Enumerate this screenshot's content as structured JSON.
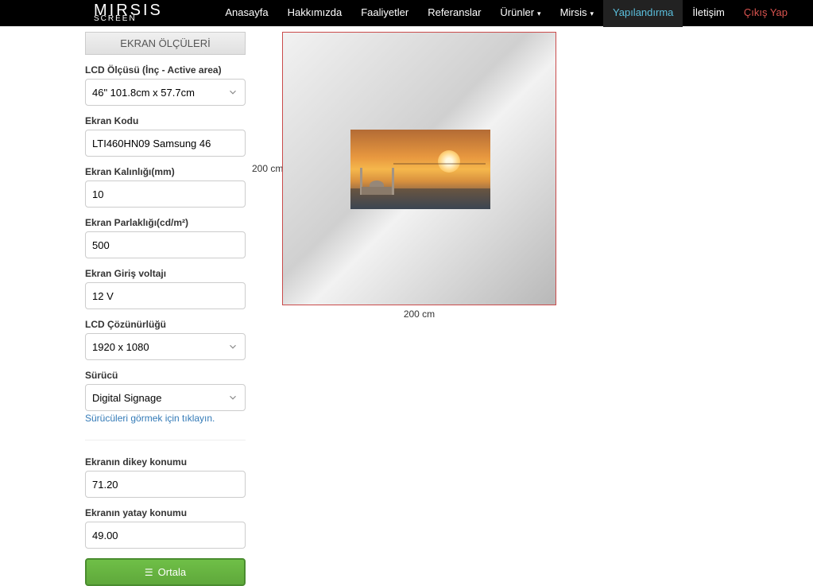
{
  "nav": {
    "logo_main": "MIRSIS",
    "logo_sub": "SCREEN",
    "anasayfa": "Anasayfa",
    "hakkimizda": "Hakkımızda",
    "faaliyetler": "Faaliyetler",
    "referanslar": "Referanslar",
    "urunler": "Ürünler",
    "mirsis": "Mirsis",
    "yapilandirma": "Yapılandırma",
    "iletisim": "İletişim",
    "cikis": "Çıkış Yap"
  },
  "form": {
    "section_title": "EKRAN ÖLÇÜLERİ",
    "lcd_size_label": "LCD Ölçüsü (İnç - Active area)",
    "lcd_size_value": "46\" 101.8cm x 57.7cm",
    "ekran_kodu_label": "Ekran Kodu",
    "ekran_kodu_value": "LTI460HN09 Samsung 46",
    "kalinlik_label": "Ekran Kalınlığı(mm)",
    "kalinlik_value": "10",
    "parlaklik_label": "Ekran Parlaklığı(cd/m²)",
    "parlaklik_value": "500",
    "voltaj_label": "Ekran Giriş voltajı",
    "voltaj_value": "12 V",
    "cozunurluk_label": "LCD Çözünürlüğü",
    "cozunurluk_value": "1920 x 1080",
    "surucu_label": "Sürücü",
    "surucu_value": "Digital Signage",
    "surucu_link": "Sürücüleri görmek için tıklayın.",
    "dikey_label": "Ekranın dikey konumu",
    "dikey_value": "71.20",
    "yatay_label": "Ekranın yatay konumu",
    "yatay_value": "49.00",
    "ortala_button": "Ortala"
  },
  "canvas": {
    "height_label": "200 cm",
    "width_label": "200 cm"
  }
}
